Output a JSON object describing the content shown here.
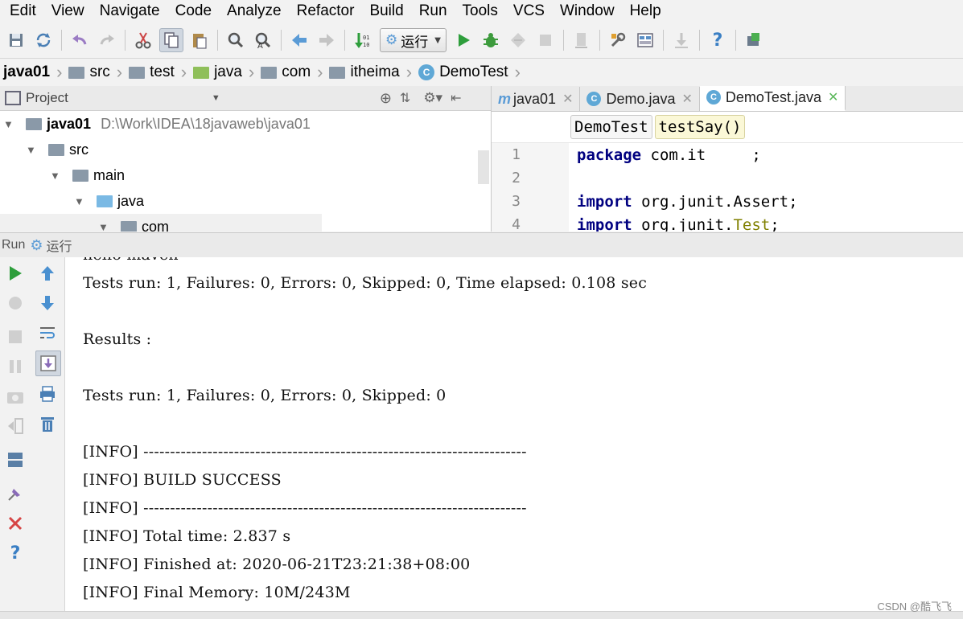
{
  "menu": [
    "Edit",
    "View",
    "Navigate",
    "Code",
    "Analyze",
    "Refactor",
    "Build",
    "Run",
    "Tools",
    "VCS",
    "Window",
    "Help"
  ],
  "toolbar": {
    "run_config_label": "运行"
  },
  "breadcrumb": [
    "java01",
    "src",
    "test",
    "java",
    "com",
    "itheima",
    "DemoTest"
  ],
  "project": {
    "panel_title": "Project",
    "tree": [
      {
        "label": "java01",
        "path": "D:\\Work\\IDEA\\18javaweb\\java01"
      },
      {
        "label": "src"
      },
      {
        "label": "main"
      },
      {
        "label": "java"
      },
      {
        "label": "com"
      }
    ]
  },
  "editor": {
    "tabs": [
      "java01",
      "Demo.java",
      "DemoTest.java"
    ],
    "crumbs": [
      "DemoTest",
      "testSay()"
    ],
    "line_numbers": [
      "1",
      "2",
      "3",
      "4"
    ],
    "lines": [
      {
        "kw": "package",
        "rest": " com.it     ;"
      },
      {
        "kw": "",
        "rest": ""
      },
      {
        "kw": "import",
        "rest": " org.junit.Assert;"
      },
      {
        "kw": "import",
        "rest": " org.junit.",
        "ann": "Test",
        "tail": ";"
      }
    ]
  },
  "run": {
    "label": "Run",
    "config": "运行"
  },
  "console": [
    "hello maven",
    "Tests run: 1, Failures: 0, Errors: 0, Skipped: 0, Time elapsed: 0.108 sec",
    "",
    "Results :",
    "",
    "Tests run: 1, Failures: 0, Errors: 0, Skipped: 0",
    "",
    "[INFO] ------------------------------------------------------------------------",
    "[INFO] BUILD SUCCESS",
    "[INFO] ------------------------------------------------------------------------",
    "[INFO] Total time: 2.837 s",
    "[INFO] Finished at: 2020-06-21T23:21:38+08:00",
    "[INFO] Final Memory: 10M/243M"
  ],
  "watermark": "CSDN @酷飞飞",
  "colors": {
    "keyword": "#000080",
    "annotation": "#808000",
    "run_green": "#2e9e3c"
  }
}
